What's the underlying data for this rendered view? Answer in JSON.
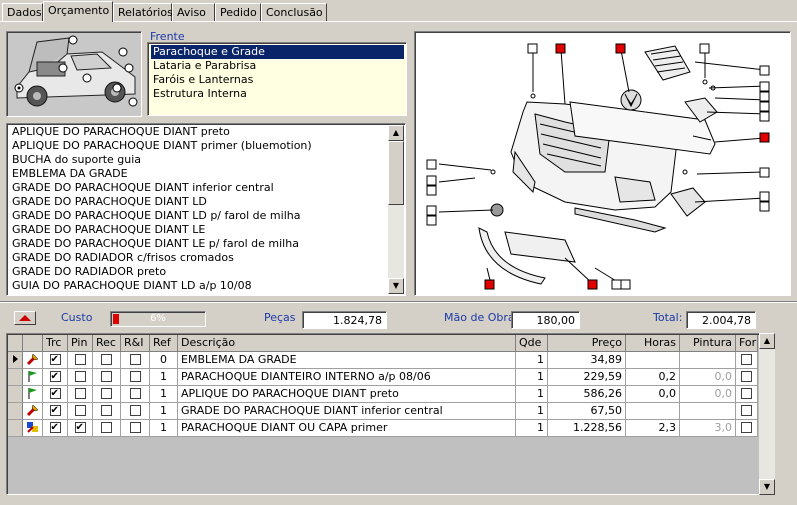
{
  "tabs": [
    "Dados",
    "Orçamento",
    "Relatórios",
    "Aviso",
    "Pedido",
    "Conclusão"
  ],
  "category_title": "Frente",
  "categories": [
    "Parachoque e Grade",
    "Lataria e Parabrisa",
    "Faróis e Lanternas",
    "Estrutura Interna"
  ],
  "parts": [
    "APLIQUE DO PARACHOQUE DIANT preto",
    "APLIQUE DO PARACHOQUE DIANT primer (bluemotion)",
    "BUCHA do suporte guia",
    "EMBLEMA DA GRADE",
    "GRADE DO PARACHOQUE DIANT inferior central",
    "GRADE DO PARACHOQUE DIANT LD",
    "GRADE DO PARACHOQUE DIANT LD p/ farol de milha",
    "GRADE DO PARACHOQUE DIANT LE",
    "GRADE DO PARACHOQUE DIANT LE p/ farol de milha",
    "GRADE DO RADIADOR c/frisos cromados",
    "GRADE DO RADIADOR preto",
    "GUIA DO PARACHOQUE DIANT LD a/p 10/08"
  ],
  "totals": {
    "custo_label": "Custo",
    "custo_percent": "6%",
    "custo_fraction": 0.06,
    "pecas_label": "Peças",
    "pecas_value": "1.824,78",
    "mao_label": "Mão de Obra",
    "mao_value": "180,00",
    "total_label": "Total:",
    "total_value": "2.004,78"
  },
  "grid": {
    "headers": [
      "Trc",
      "Pin",
      "Rec",
      "R&I",
      "Ref",
      "Descrição",
      "Qde",
      "Preço",
      "Horas",
      "Pintura",
      "For"
    ],
    "rows": [
      {
        "trc": true,
        "pin": false,
        "rec": false,
        "ri": false,
        "ref": "0",
        "desc": "EMBLEMA DA GRADE",
        "qde": "1",
        "preco": "34,89",
        "horas": "",
        "pintura": "",
        "for": false,
        "icon": "tool-icon"
      },
      {
        "trc": true,
        "pin": false,
        "rec": false,
        "ri": false,
        "ref": "1",
        "desc": "PARACHOQUE DIANTEIRO INTERNO a/p 08/06",
        "qde": "1",
        "preco": "229,59",
        "horas": "0,2",
        "pintura": "0,0",
        "for": false,
        "icon": "flag-icon"
      },
      {
        "trc": true,
        "pin": false,
        "rec": false,
        "ri": false,
        "ref": "1",
        "desc": "APLIQUE DO PARACHOQUE DIANT preto",
        "qde": "1",
        "preco": "586,26",
        "horas": "0,0",
        "pintura": "0,0",
        "for": false,
        "icon": "flag-icon"
      },
      {
        "trc": true,
        "pin": false,
        "rec": false,
        "ri": false,
        "ref": "1",
        "desc": "GRADE DO PARACHOQUE DIANT inferior central",
        "qde": "1",
        "preco": "67,50",
        "horas": "",
        "pintura": "",
        "for": false,
        "icon": "tool-icon"
      },
      {
        "trc": true,
        "pin": true,
        "rec": false,
        "ri": false,
        "ref": "1",
        "desc": "PARACHOQUE DIANT OU CAPA primer",
        "qde": "1",
        "preco": "1.228,56",
        "horas": "2,3",
        "pintura": "3,0",
        "for": false,
        "icon": "paint-icon"
      }
    ]
  },
  "colors": {
    "selection": "#0a246a",
    "label_blue": "#1c3aa8",
    "list_bg": "#ffffe1",
    "marker_red": "#e00000"
  }
}
